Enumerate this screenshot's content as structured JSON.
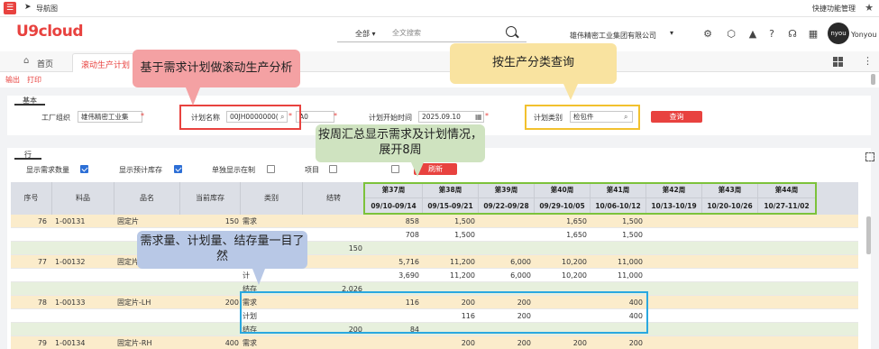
{
  "topnav": {
    "nav_title": "导航图",
    "shortcut": "快捷功能管理"
  },
  "header": {
    "logo": "U9cloud",
    "scope": "全部",
    "search_placeholder": "全文搜索",
    "company": "雄伟精密工业集团有限公司",
    "avatar_text": "nyou",
    "username": "Yonyou"
  },
  "tabs": {
    "home": "首页",
    "active": "滚动生产计划"
  },
  "toolbar": {
    "output": "输出",
    "print": "打印"
  },
  "basic": {
    "tab": "基本",
    "org_label": "工厂组织",
    "org_value": "雄伟精密工业集",
    "plan_name_label": "计划名称",
    "plan_name_value": "00JH0000000(",
    "extra_value": "A0",
    "start_label": "计划开始时间",
    "start_value": "2025.09.10",
    "category_label": "计划类别",
    "category_value": "检包件",
    "query_button": "查询"
  },
  "row_section": {
    "tab": "行",
    "options": [
      {
        "label": "显示需求数量",
        "checked": true
      },
      {
        "label": "显示预计库存",
        "checked": true
      },
      {
        "label": "单独显示在制",
        "checked": false
      },
      {
        "label": "项目",
        "checked": false
      },
      {
        "label": "项目",
        "checked": false
      }
    ],
    "refresh_button": "刷新"
  },
  "table": {
    "headers": [
      "序号",
      "料品",
      "品名",
      "当前库存",
      "类别",
      "结转"
    ],
    "weeks": [
      {
        "name": "第37周",
        "range": "09/10-09/14"
      },
      {
        "name": "第38周",
        "range": "09/15-09/21"
      },
      {
        "name": "第39周",
        "range": "09/22-09/28"
      },
      {
        "name": "第40周",
        "range": "09/29-10/05"
      },
      {
        "name": "第41周",
        "range": "10/06-10/12"
      },
      {
        "name": "第42周",
        "range": "10/13-10/19"
      },
      {
        "name": "第43周",
        "range": "10/20-10/26"
      },
      {
        "name": "第44周",
        "range": "10/27-11/02"
      }
    ],
    "rows": [
      {
        "kind": "demand",
        "seq": "76",
        "item": "1-00131",
        "name": "固定片",
        "stock": "150",
        "cat": "需求",
        "carry": "",
        "w": [
          "858",
          "1,500",
          "",
          "1,650",
          "1,500",
          "",
          "",
          ""
        ]
      },
      {
        "kind": "plan",
        "seq": "",
        "item": "",
        "name": "",
        "stock": "",
        "cat": "",
        "carry": "",
        "w": [
          "708",
          "1,500",
          "",
          "1,650",
          "1,500",
          "",
          "",
          ""
        ]
      },
      {
        "kind": "bal",
        "seq": "",
        "item": "",
        "name": "",
        "stock": "",
        "cat": "",
        "carry": "150",
        "w": [
          "",
          "",
          "",
          "",
          "",
          "",
          "",
          ""
        ]
      },
      {
        "kind": "demand",
        "seq": "77",
        "item": "1-00132",
        "name": "固定片",
        "stock": "",
        "cat": "",
        "carry": "",
        "w": [
          "5,716",
          "11,200",
          "6,000",
          "10,200",
          "11,000",
          "",
          "",
          ""
        ]
      },
      {
        "kind": "plan",
        "seq": "",
        "item": "",
        "name": "",
        "stock": "",
        "cat": "计",
        "carry": "",
        "w": [
          "3,690",
          "11,200",
          "6,000",
          "10,200",
          "11,000",
          "",
          "",
          ""
        ]
      },
      {
        "kind": "bal",
        "seq": "",
        "item": "",
        "name": "",
        "stock": "",
        "cat": "结存",
        "carry": "2,026",
        "w": [
          "",
          "",
          "",
          "",
          "",
          "",
          "",
          ""
        ]
      },
      {
        "kind": "demand",
        "seq": "78",
        "item": "1-00133",
        "name": "固定片-LH",
        "stock": "200",
        "cat": "需求",
        "carry": "",
        "w": [
          "116",
          "200",
          "200",
          "",
          "400",
          "",
          "",
          ""
        ]
      },
      {
        "kind": "plan",
        "seq": "",
        "item": "",
        "name": "",
        "stock": "",
        "cat": "计划",
        "carry": "",
        "w": [
          "",
          "116",
          "200",
          "",
          "400",
          "",
          "",
          ""
        ]
      },
      {
        "kind": "bal",
        "seq": "",
        "item": "",
        "name": "",
        "stock": "",
        "cat": "结存",
        "carry": "200",
        "w": [
          "84",
          "",
          "",
          "",
          "",
          "",
          "",
          ""
        ]
      },
      {
        "kind": "demand",
        "seq": "79",
        "item": "1-00134",
        "name": "固定片-RH",
        "stock": "400",
        "cat": "需求",
        "carry": "",
        "w": [
          "",
          "200",
          "200",
          "200",
          "200",
          "",
          "",
          ""
        ]
      }
    ]
  },
  "callouts": {
    "rolling": "基于需求计划做滚动生产分析",
    "category": "按生产分类查询",
    "weekly": "按周汇总显示需求及计划情况，展开8周",
    "visible": "需求量、计划量、结存量一目了然"
  },
  "colors": {
    "brand": "#e8423f",
    "demand_row": "#fbeccb",
    "balance_row": "#e7f0dd",
    "highlight_red": "#e8423f",
    "highlight_yellow": "#f2c12e",
    "highlight_green": "#7cc23b",
    "highlight_blue": "#2aa8e0"
  }
}
